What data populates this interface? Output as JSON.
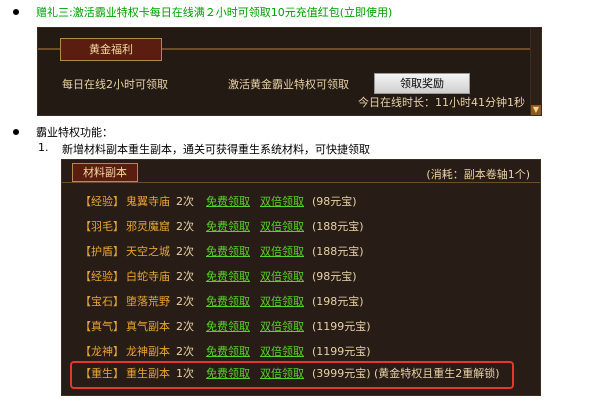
{
  "gift3": {
    "label": "赠礼三:激活霸业特权卡每日在线满２小时可领取10元充值红包(立即使用)"
  },
  "panel1": {
    "tab_label": "黄金福利",
    "daily_online_text": "每日在线2小时可领取",
    "activate_text": "激活黄金霸业特权可领取",
    "claim_button": "领取奖励",
    "online_today": "今日在线时长：11小时41分钟1秒"
  },
  "features": {
    "title": "霸业特权功能：",
    "item1_number": "1.",
    "item1_text": "新增材料副本重生副本，通关可获得重生系统材料，可快捷领取"
  },
  "panel2": {
    "tab_label": "材料副本",
    "consume_text": "(消耗：副本卷轴1个)",
    "rows": [
      {
        "cat": "【经验】",
        "name": "鬼翼寺庙",
        "times": "2次",
        "free": "免费领取",
        "double": "双倍领取",
        "price": "(98元宝)",
        "note": ""
      },
      {
        "cat": "【羽毛】",
        "name": "邪灵魔窟",
        "times": "2次",
        "free": "免费领取",
        "double": "双倍领取",
        "price": "(188元宝)",
        "note": ""
      },
      {
        "cat": "【护盾】",
        "name": "天空之城",
        "times": "2次",
        "free": "免费领取",
        "double": "双倍领取",
        "price": "(188元宝)",
        "note": ""
      },
      {
        "cat": "【经验】",
        "name": "白蛇寺庙",
        "times": "2次",
        "free": "免费领取",
        "double": "双倍领取",
        "price": "(98元宝)",
        "note": ""
      },
      {
        "cat": "【宝石】",
        "name": "堕落荒野",
        "times": "2次",
        "free": "免费领取",
        "double": "双倍领取",
        "price": "(198元宝)",
        "note": ""
      },
      {
        "cat": "【真气】",
        "name": "真气副本",
        "times": "2次",
        "free": "免费领取",
        "double": "双倍领取",
        "price": "(1199元宝)",
        "note": ""
      },
      {
        "cat": "【龙神】",
        "name": "龙神副本",
        "times": "2次",
        "free": "免费领取",
        "double": "双倍领取",
        "price": "(1199元宝)",
        "note": ""
      },
      {
        "cat": "【重生】",
        "name": "重生副本",
        "times": "1次",
        "free": "免费领取",
        "double": "双倍领取",
        "price": "(3999元宝)",
        "note": "(黄金特权且重生2重解锁)"
      }
    ]
  }
}
